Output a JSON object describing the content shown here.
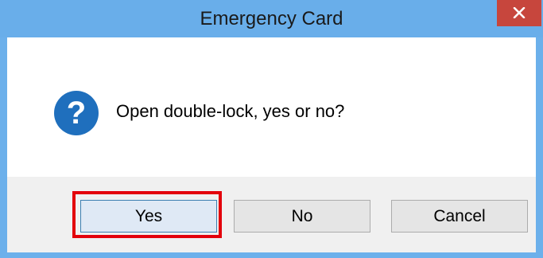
{
  "window": {
    "title": "Emergency Card",
    "close_icon": "close-icon"
  },
  "dialog": {
    "icon": "question-icon",
    "message": "Open double-lock, yes or no?"
  },
  "buttons": {
    "yes_label": "Yes",
    "no_label": "No",
    "cancel_label": "Cancel"
  },
  "colors": {
    "titlebar": "#69aeea",
    "close_button": "#c7463d",
    "question_icon": "#1f6fbd",
    "highlight": "#e3000b"
  }
}
